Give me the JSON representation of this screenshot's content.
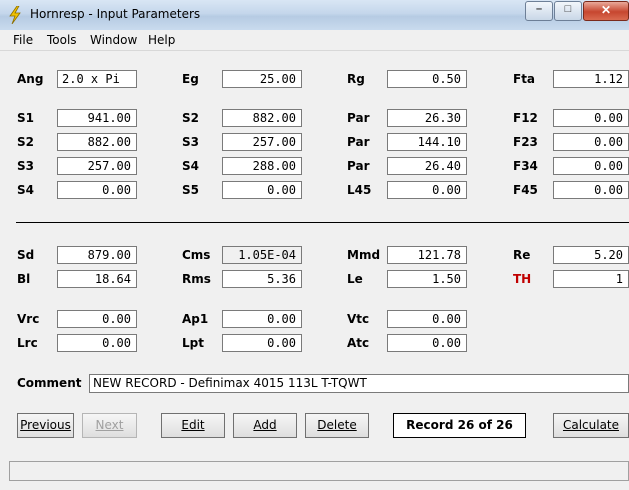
{
  "window": {
    "title": "Hornresp - Input Parameters",
    "minimize": "–",
    "maximize": "□",
    "close": "✕"
  },
  "menu": [
    "File",
    "Tools",
    "Window",
    "Help"
  ],
  "params": {
    "Ang": {
      "label": "Ang",
      "value": "2.0 x Pi"
    },
    "Eg": {
      "label": "Eg",
      "value": "25.00"
    },
    "Rg": {
      "label": "Rg",
      "value": "0.50"
    },
    "Fta": {
      "label": "Fta",
      "value": "1.12"
    },
    "S1": {
      "label": "S1",
      "value": "941.00"
    },
    "S2a": {
      "label": "S2",
      "value": "882.00"
    },
    "Par1": {
      "label": "Par",
      "value": "26.30"
    },
    "F12": {
      "label": "F12",
      "value": "0.00"
    },
    "S2b": {
      "label": "S2",
      "value": "882.00"
    },
    "S3a": {
      "label": "S3",
      "value": "257.00"
    },
    "Par2": {
      "label": "Par",
      "value": "144.10"
    },
    "F23": {
      "label": "F23",
      "value": "0.00"
    },
    "S3b": {
      "label": "S3",
      "value": "257.00"
    },
    "S4a": {
      "label": "S4",
      "value": "288.00"
    },
    "Par3": {
      "label": "Par",
      "value": "26.40"
    },
    "F34": {
      "label": "F34",
      "value": "0.00"
    },
    "S4b": {
      "label": "S4",
      "value": "0.00"
    },
    "S5": {
      "label": "S5",
      "value": "0.00"
    },
    "L45": {
      "label": "L45",
      "value": "0.00"
    },
    "F45": {
      "label": "F45",
      "value": "0.00"
    },
    "Sd": {
      "label": "Sd",
      "value": "879.00"
    },
    "Cms": {
      "label": "Cms",
      "value": "1.05E-04"
    },
    "Mmd": {
      "label": "Mmd",
      "value": "121.78"
    },
    "Re": {
      "label": "Re",
      "value": "5.20"
    },
    "Bl": {
      "label": "Bl",
      "value": "18.64"
    },
    "Rms": {
      "label": "Rms",
      "value": "5.36"
    },
    "Le": {
      "label": "Le",
      "value": "1.50"
    },
    "TH": {
      "label": "TH",
      "value": "1"
    },
    "Vrc": {
      "label": "Vrc",
      "value": "0.00"
    },
    "Ap1": {
      "label": "Ap1",
      "value": "0.00"
    },
    "Vtc": {
      "label": "Vtc",
      "value": "0.00"
    },
    "Lrc": {
      "label": "Lrc",
      "value": "0.00"
    },
    "Lpt": {
      "label": "Lpt",
      "value": "0.00"
    },
    "Atc": {
      "label": "Atc",
      "value": "0.00"
    }
  },
  "comment": {
    "label": "Comment",
    "value": "NEW RECORD - Definimax 4015  113L T-TQWT"
  },
  "buttons": {
    "previous": "Previous",
    "next": "Next",
    "edit": "Edit",
    "add": "Add",
    "delete": "Delete",
    "calculate": "Calculate"
  },
  "record": "Record 26 of 26",
  "colors": {
    "accent_label": "#c00000",
    "title_gradient": "#c4d6eb"
  }
}
